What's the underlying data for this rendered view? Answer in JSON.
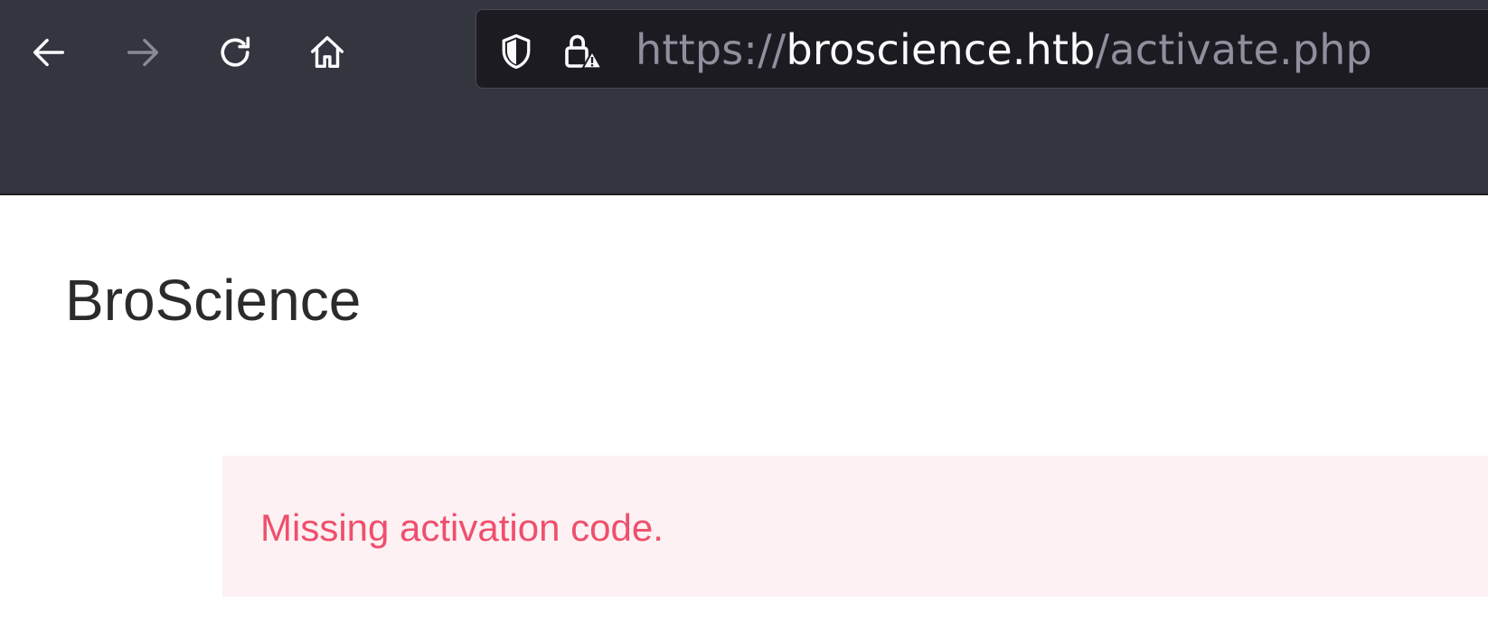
{
  "browser": {
    "url": {
      "scheme": "https://",
      "host": "broscience.htb",
      "path": "/activate.php"
    },
    "buttons": {
      "back": "back-arrow-icon",
      "forward": "forward-arrow-icon",
      "reload": "reload-icon",
      "home": "home-icon"
    },
    "forward_disabled": true,
    "colors": {
      "chrome_bg": "#33353f",
      "urlbar_bg": "#1c1b22",
      "url_dim": "#8f8f9d",
      "url_host": "#fbfbfe"
    }
  },
  "page": {
    "site_title": "BroScience",
    "alert": {
      "message": "Missing activation code.",
      "text_color": "#ef4f6d",
      "bg_color": "#fdf1f3"
    }
  }
}
